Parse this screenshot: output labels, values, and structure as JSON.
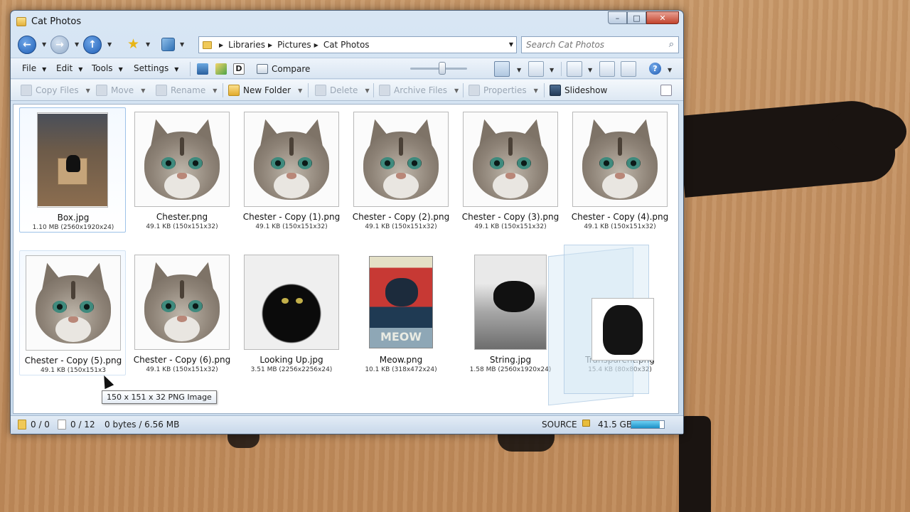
{
  "window": {
    "title": "Cat Photos",
    "minimize": "–",
    "maximize": "□",
    "close": "✕"
  },
  "nav": {
    "breadcrumbs": [
      "Libraries",
      "Pictures",
      "Cat Photos"
    ],
    "search_placeholder": "Search Cat Photos"
  },
  "menu": {
    "file": "File",
    "edit": "Edit",
    "tools": "Tools",
    "settings": "Settings",
    "compare": "Compare",
    "help": "?"
  },
  "commands": {
    "copy_files": "Copy Files",
    "move": "Move",
    "rename": "Rename",
    "new_folder": "New Folder",
    "delete": "Delete",
    "archive_files": "Archive Files",
    "properties": "Properties",
    "slideshow": "Slideshow"
  },
  "files": [
    {
      "name": "Box.jpg",
      "meta": "1.10 MB (2560x1920x24)"
    },
    {
      "name": "Chester.png",
      "meta": "49.1 KB (150x151x32)"
    },
    {
      "name": "Chester - Copy (1).png",
      "meta": "49.1 KB (150x151x32)"
    },
    {
      "name": "Chester - Copy (2).png",
      "meta": "49.1 KB (150x151x32)"
    },
    {
      "name": "Chester - Copy (3).png",
      "meta": "49.1 KB (150x151x32)"
    },
    {
      "name": "Chester - Copy (4).png",
      "meta": "49.1 KB (150x151x32)"
    },
    {
      "name": "Chester - Copy (5).png",
      "meta": "49.1 KB (150x151x3"
    },
    {
      "name": "Chester - Copy (6).png",
      "meta": "49.1 KB (150x151x32)"
    },
    {
      "name": "Looking Up.jpg",
      "meta": "3.51 MB (2256x2256x24)"
    },
    {
      "name": "Meow.png",
      "meta": "10.1 KB (318x472x24)",
      "poster_text": "MEOW"
    },
    {
      "name": "String.jpg",
      "meta": "1.58 MB (2560x1920x24)"
    },
    {
      "name": "Transparent.png",
      "meta": "15.4 KB (80x80x32)"
    }
  ],
  "tooltip": "150 x 151 x 32 PNG Image",
  "status": {
    "folders": "0 / 0",
    "files": "0 / 12",
    "size": "0 bytes / 6.56 MB",
    "source": "SOURCE",
    "free_space": "41.5 GB",
    "disk_fill_fraction": 0.88
  }
}
